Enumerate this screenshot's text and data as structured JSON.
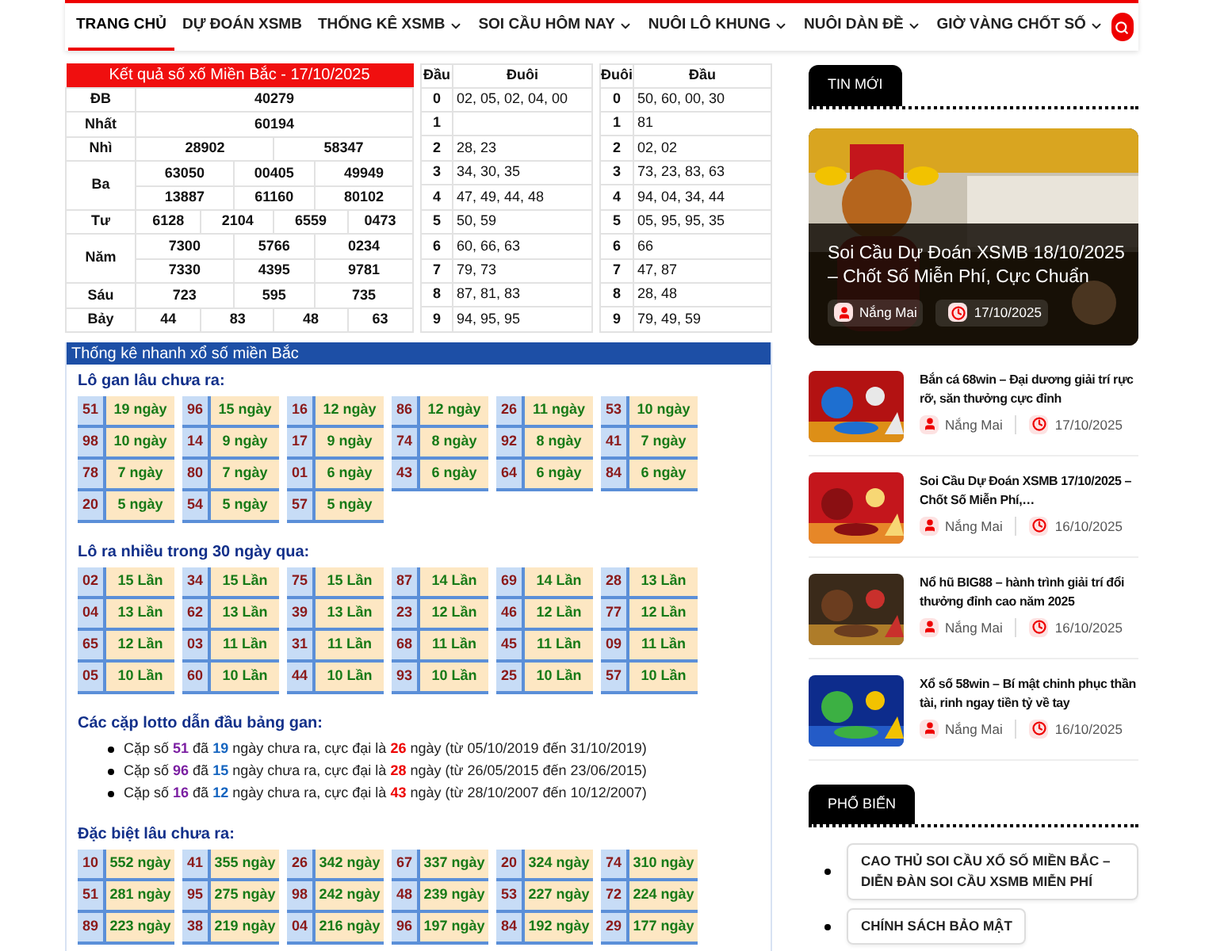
{
  "nav": {
    "items": [
      {
        "label": "TRANG CHỦ",
        "selected": true,
        "dropdown": false
      },
      {
        "label": "DỰ ĐOÁN XSMB",
        "selected": false,
        "dropdown": false
      },
      {
        "label": "THỐNG KÊ XSMB",
        "selected": false,
        "dropdown": true
      },
      {
        "label": "SOI CẦU HÔM NAY",
        "selected": false,
        "dropdown": true
      },
      {
        "label": "NUÔI LÔ KHUNG",
        "selected": false,
        "dropdown": true
      },
      {
        "label": "NUÔI DÀN ĐỀ",
        "selected": false,
        "dropdown": true
      },
      {
        "label": "GIỜ VÀNG CHỐT SỐ",
        "selected": false,
        "dropdown": true
      }
    ]
  },
  "results": {
    "title": "Kết quả số xố Miền Bắc - 17/10/2025",
    "prizes": [
      {
        "label": "ĐB",
        "rows": [
          [
            "40279"
          ]
        ]
      },
      {
        "label": "Nhất",
        "rows": [
          [
            "60194"
          ]
        ]
      },
      {
        "label": "Nhì",
        "rows": [
          [
            "28902",
            "58347"
          ]
        ]
      },
      {
        "label": "Ba",
        "rows": [
          [
            "63050",
            "00405",
            "49949"
          ],
          [
            "13887",
            "61160",
            "80102"
          ]
        ]
      },
      {
        "label": "Tư",
        "rows": [
          [
            "6128",
            "2104",
            "6559",
            "0473"
          ]
        ]
      },
      {
        "label": "Năm",
        "rows": [
          [
            "7300",
            "5766",
            "0234"
          ],
          [
            "7330",
            "4395",
            "9781"
          ]
        ]
      },
      {
        "label": "Sáu",
        "rows": [
          [
            "723",
            "595",
            "735"
          ]
        ]
      },
      {
        "label": "Bảy",
        "rows": [
          [
            "44",
            "83",
            "48",
            "63"
          ]
        ]
      }
    ]
  },
  "loto_tables": [
    {
      "columns": [
        "Đầu",
        "Đuôi"
      ],
      "rows": [
        {
          "key": "0",
          "values": "02, 05, 02, 04, 00"
        },
        {
          "key": "1"
        },
        {
          "key": "2",
          "values": "28, 23"
        },
        {
          "key": "3",
          "values": "34, 30, 35"
        },
        {
          "key": "4",
          "values": "47, 49, 44, 48"
        },
        {
          "key": "5",
          "values": "50, 59"
        },
        {
          "key": "6",
          "values": "60, 66, 63"
        },
        {
          "key": "7",
          "values": "79, 73"
        },
        {
          "key": "8",
          "values": "87, 81, 83"
        },
        {
          "key": "9",
          "values": "94, 95, 95"
        }
      ]
    },
    {
      "columns": [
        "Đuôi",
        "Đầu"
      ],
      "rows": [
        {
          "key": "0",
          "values": "50, 60, 00, 30"
        },
        {
          "key": "1",
          "values": "81"
        },
        {
          "key": "2",
          "values": "02, 02"
        },
        {
          "key": "3",
          "values": "73, 23, 83, 63"
        },
        {
          "key": "4",
          "values": "94, 04, 34, 44"
        },
        {
          "key": "5",
          "values": "05, 95, 95, 35"
        },
        {
          "key": "6",
          "values": "66"
        },
        {
          "key": "7",
          "values": "47, 87"
        },
        {
          "key": "8",
          "values": "28, 48"
        },
        {
          "key": "9",
          "values": "79, 49, 59"
        }
      ]
    }
  ],
  "stats": {
    "title": "Thống kê nhanh xổ số miền Bắc",
    "sections": [
      {
        "kind": "grid",
        "title": "Lô gan lâu chưa ra:",
        "items": [
          {
            "number": "51",
            "value": "19 ngày"
          },
          {
            "number": "96",
            "value": "15 ngày"
          },
          {
            "number": "16",
            "value": "12 ngày"
          },
          {
            "number": "86",
            "value": "12 ngày"
          },
          {
            "number": "26",
            "value": "11 ngày"
          },
          {
            "number": "53",
            "value": "10 ngày"
          },
          {
            "number": "98",
            "value": "10 ngày"
          },
          {
            "number": "14",
            "value": "9 ngày"
          },
          {
            "number": "17",
            "value": "9 ngày"
          },
          {
            "number": "74",
            "value": "8 ngày"
          },
          {
            "number": "92",
            "value": "8 ngày"
          },
          {
            "number": "41",
            "value": "7 ngày"
          },
          {
            "number": "78",
            "value": "7 ngày"
          },
          {
            "number": "80",
            "value": "7 ngày"
          },
          {
            "number": "01",
            "value": "6 ngày"
          },
          {
            "number": "43",
            "value": "6 ngày"
          },
          {
            "number": "64",
            "value": "6 ngày"
          },
          {
            "number": "84",
            "value": "6 ngày"
          },
          {
            "number": "20",
            "value": "5 ngày"
          },
          {
            "number": "54",
            "value": "5 ngày"
          },
          {
            "number": "57",
            "value": "5 ngày"
          }
        ]
      },
      {
        "kind": "grid",
        "title": "Lô ra nhiều trong 30 ngày qua:",
        "items": [
          {
            "number": "02",
            "value": "15 Lần"
          },
          {
            "number": "34",
            "value": "15 Lần"
          },
          {
            "number": "75",
            "value": "15 Lần"
          },
          {
            "number": "87",
            "value": "14 Lần"
          },
          {
            "number": "69",
            "value": "14 Lần"
          },
          {
            "number": "28",
            "value": "13 Lần"
          },
          {
            "number": "04",
            "value": "13 Lần"
          },
          {
            "number": "62",
            "value": "13 Lần"
          },
          {
            "number": "39",
            "value": "13 Lần"
          },
          {
            "number": "23",
            "value": "12 Lần"
          },
          {
            "number": "46",
            "value": "12 Lần"
          },
          {
            "number": "77",
            "value": "12 Lần"
          },
          {
            "number": "65",
            "value": "12 Lần"
          },
          {
            "number": "03",
            "value": "11 Lần"
          },
          {
            "number": "31",
            "value": "11 Lần"
          },
          {
            "number": "68",
            "value": "11 Lần"
          },
          {
            "number": "45",
            "value": "11 Lần"
          },
          {
            "number": "09",
            "value": "11 Lần"
          },
          {
            "number": "05",
            "value": "10 Lần"
          },
          {
            "number": "60",
            "value": "10 Lần"
          },
          {
            "number": "44",
            "value": "10 Lần"
          },
          {
            "number": "93",
            "value": "10 Lần"
          },
          {
            "number": "25",
            "value": "10 Lần"
          },
          {
            "number": "57",
            "value": "10 Lần"
          }
        ]
      },
      {
        "kind": "list",
        "title": "Các cặp lotto dẫn đầu bảng gan:",
        "items": [
          {
            "segments": [
              {
                "kind": "text",
                "text": "Cặp số "
              },
              {
                "kind": "pair",
                "text": "51"
              },
              {
                "kind": "text",
                "text": " đã "
              },
              {
                "kind": "current",
                "text": "19"
              },
              {
                "kind": "text",
                "text": " ngày chưa ra, cực đại là "
              },
              {
                "kind": "max",
                "text": "26"
              },
              {
                "kind": "text",
                "text": " ngày (từ 05/10/2019 đến 31/10/2019)"
              }
            ]
          },
          {
            "segments": [
              {
                "kind": "text",
                "text": "Cặp số "
              },
              {
                "kind": "pair",
                "text": "96"
              },
              {
                "kind": "text",
                "text": " đã "
              },
              {
                "kind": "current",
                "text": "15"
              },
              {
                "kind": "text",
                "text": " ngày chưa ra, cực đại là "
              },
              {
                "kind": "max",
                "text": "28"
              },
              {
                "kind": "text",
                "text": " ngày (từ 26/05/2015 đến 23/06/2015)"
              }
            ]
          },
          {
            "segments": [
              {
                "kind": "text",
                "text": "Cặp số "
              },
              {
                "kind": "pair",
                "text": "16"
              },
              {
                "kind": "text",
                "text": " đã "
              },
              {
                "kind": "current",
                "text": "12"
              },
              {
                "kind": "text",
                "text": " ngày chưa ra, cực đại là "
              },
              {
                "kind": "max",
                "text": "43"
              },
              {
                "kind": "text",
                "text": " ngày (từ 28/10/2007 đến 10/12/2007)"
              }
            ]
          }
        ]
      },
      {
        "kind": "grid",
        "title": "Đặc biệt lâu chưa ra:",
        "items": [
          {
            "number": "10",
            "value": "552 ngày"
          },
          {
            "number": "41",
            "value": "355 ngày"
          },
          {
            "number": "26",
            "value": "342 ngày"
          },
          {
            "number": "67",
            "value": "337 ngày"
          },
          {
            "number": "20",
            "value": "324 ngày"
          },
          {
            "number": "74",
            "value": "310 ngày"
          },
          {
            "number": "51",
            "value": "281 ngày"
          },
          {
            "number": "95",
            "value": "275 ngày"
          },
          {
            "number": "98",
            "value": "242 ngày"
          },
          {
            "number": "48",
            "value": "239 ngày"
          },
          {
            "number": "53",
            "value": "227 ngày"
          },
          {
            "number": "72",
            "value": "224 ngày"
          },
          {
            "number": "89",
            "value": "223 ngày"
          },
          {
            "number": "38",
            "value": "219 ngày"
          },
          {
            "number": "04",
            "value": "216 ngày"
          },
          {
            "number": "96",
            "value": "197 ngày"
          },
          {
            "number": "84",
            "value": "192 ngày"
          },
          {
            "number": "29",
            "value": "177 ngày"
          }
        ]
      }
    ]
  },
  "sidebar": {
    "news_tab": "TIN MỚI",
    "featured": {
      "title": "Soi Cầu Dự Đoán XSMB 18/10/2025 – Chốt Số Miễn Phí, Cực Chuẩn",
      "author": "Nắng Mai",
      "date": "17/10/2025"
    },
    "posts": [
      {
        "title": "Bắn cá 68win – Đại dương giải trí rực rỡ, săn thưởng cực đỉnh",
        "author": "Nắng Mai",
        "date": "17/10/2025"
      },
      {
        "title": "Soi Cầu Dự Đoán XSMB 17/10/2025 – Chốt Số Miễn Phí,…",
        "author": "Nắng Mai",
        "date": "16/10/2025"
      },
      {
        "title": "Nổ hũ BIG88 – hành trình giải trí đổi thưởng đỉnh cao năm 2025",
        "author": "Nắng Mai",
        "date": "16/10/2025"
      },
      {
        "title": "Xổ số 58win – Bí mật chinh phục thần tài, rinh ngay tiền tỷ về tay",
        "author": "Nắng Mai",
        "date": "16/10/2025"
      }
    ],
    "popular_tab": "PHỔ BIẾN",
    "popular": [
      "CAO THỦ SOI CẦU XỔ SỐ MIỀN BẮC – DIỄN ĐÀN SOI CẦU XSMB MIỄN PHÍ",
      "CHÍNH SÁCH BẢO MẬT"
    ]
  }
}
